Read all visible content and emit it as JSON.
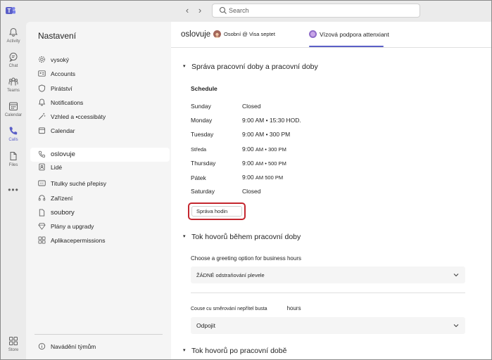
{
  "search": {
    "placeholder": "Search"
  },
  "rail": {
    "items": [
      {
        "label": "Activity",
        "icon": "bell-icon"
      },
      {
        "label": "Chat",
        "icon": "chat-icon"
      },
      {
        "label": "Teams",
        "icon": "teams-icon"
      },
      {
        "label": "Calendar",
        "icon": "calendar-icon"
      },
      {
        "label": "Calls",
        "icon": "phone-icon"
      },
      {
        "label": "Files",
        "icon": "file-icon"
      },
      {
        "label": "Store",
        "icon": "store-icon"
      }
    ],
    "more": "•••"
  },
  "settings": {
    "title": "Nastavení",
    "items": [
      {
        "label": "vysoký"
      },
      {
        "label": "Accounts"
      },
      {
        "label": "Pirátství"
      },
      {
        "label": "Notifications"
      },
      {
        "label": "Vzhled a •ccessibáty"
      },
      {
        "label": "Calendar"
      },
      {
        "label": "oslovuje"
      },
      {
        "label": "Lidé"
      },
      {
        "label": "Titulky suché přepisy"
      },
      {
        "label": "Zařízení"
      },
      {
        "label": "soubory"
      },
      {
        "label": "Plány a upgrady"
      },
      {
        "label": "Aplikacepermissions"
      }
    ],
    "footer": "Navádění týmům"
  },
  "header": {
    "title": "oslovuje",
    "account": "Osobní @ Visa septet",
    "tab": "Vízová podpora attenxiant"
  },
  "section1": {
    "title": "Správa pracovní doby a pracovní doby",
    "schedule_title": "Schedule",
    "days": [
      {
        "day": "Sunday",
        "hours": "Closed"
      },
      {
        "day": "Monday",
        "start": "9:00",
        "rest": "AM • 15:30 HOD."
      },
      {
        "day": "Tuesday",
        "start": "9:00",
        "rest": "AM • 300 PM"
      },
      {
        "day": "Středa",
        "start": "9:00",
        "rest": "AM • 300 PM"
      },
      {
        "day": "Thursday",
        "start": "9:00",
        "rest": "AM • 500 PM"
      },
      {
        "day": "Pátek",
        "start": "9:00",
        "rest": "AM 500 PM"
      },
      {
        "day": "Saturday",
        "hours": "Closed"
      }
    ],
    "manage_button": "Správa hodin"
  },
  "section2": {
    "title": "Tok hovorů během pracovní doby",
    "greeting_label": "Choose a greeting option for business hours",
    "greeting_value": "ŽÁDNÉ odstraňování plevele",
    "routing_label": "Couse cu směrování nepřítel busta",
    "routing_label_suffix": "hours",
    "routing_value": "Odpojit"
  },
  "section3": {
    "title": "Tok hovorů po pracovní době"
  },
  "colors": {
    "accent": "#5b5fc7",
    "highlight_border": "#c4262e"
  }
}
